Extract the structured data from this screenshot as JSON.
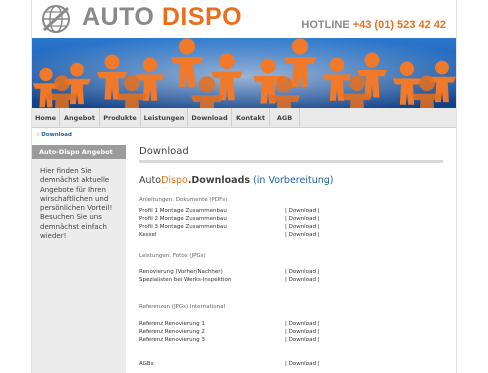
{
  "header": {
    "logo_auto": "AUTO",
    "logo_dispo": "DISPO",
    "hotline_label": "HOTLINE",
    "hotline_number": "+43 (01) 523 42 42"
  },
  "nav": {
    "items": [
      "Home",
      "Angebot",
      "Produkte",
      "Leistungen",
      "Download",
      "Kontakt",
      "AGB"
    ]
  },
  "breadcrumb": "Download",
  "sidebar": {
    "heading": "Auto-Dispo Angebot",
    "text": "Hier finden Sie demnächst aktuelle Angebote für Ihren wirschaftlichen und persönlichen Vorteil! Besuchen Sie uns demnächst einfach wieder!"
  },
  "main": {
    "title": "Download",
    "sub_auto": "Auto",
    "sub_dispo": "Dispo",
    "sub_downloads": ".Downloads",
    "sub_note": "(in Vorbereitung)",
    "sections": [
      {
        "label": "Anleitungen: Dokumente (PDFs)",
        "rows": [
          {
            "name": "Profil 1 Montage Zusammenbau",
            "link": "| Download |"
          },
          {
            "name": "Profil 2 Montage Zusammenbau",
            "link": "| Download |"
          },
          {
            "name": "Profil 3 Montage Zusammenbau",
            "link": "| Download |"
          },
          {
            "name": "Kessel",
            "link": "| Download |"
          }
        ]
      },
      {
        "label": "Leistungen: Fotos (JPGs)",
        "rows": [
          {
            "name": "Renovierung (Vorher/Nachher)",
            "link": "| Download |"
          },
          {
            "name": "Spezialisten bei Werks-Inspektion",
            "link": "| Download |"
          }
        ]
      },
      {
        "label": "Referenzen (JPGs) International",
        "rows": [
          {
            "name": "Referenz Renovierung 1",
            "link": "| Download |"
          },
          {
            "name": "Referenz Renovierung 2",
            "link": "| Download |"
          },
          {
            "name": "Referenz Renovierung 3",
            "link": "| Download |"
          }
        ]
      },
      {
        "label": "",
        "rows": [
          {
            "name": "AGBs",
            "link": "| Download |"
          }
        ]
      }
    ]
  },
  "colors": {
    "accent": "#e8701c",
    "banner_blue": "#1f63b5",
    "link_blue": "#1f5fa8"
  }
}
